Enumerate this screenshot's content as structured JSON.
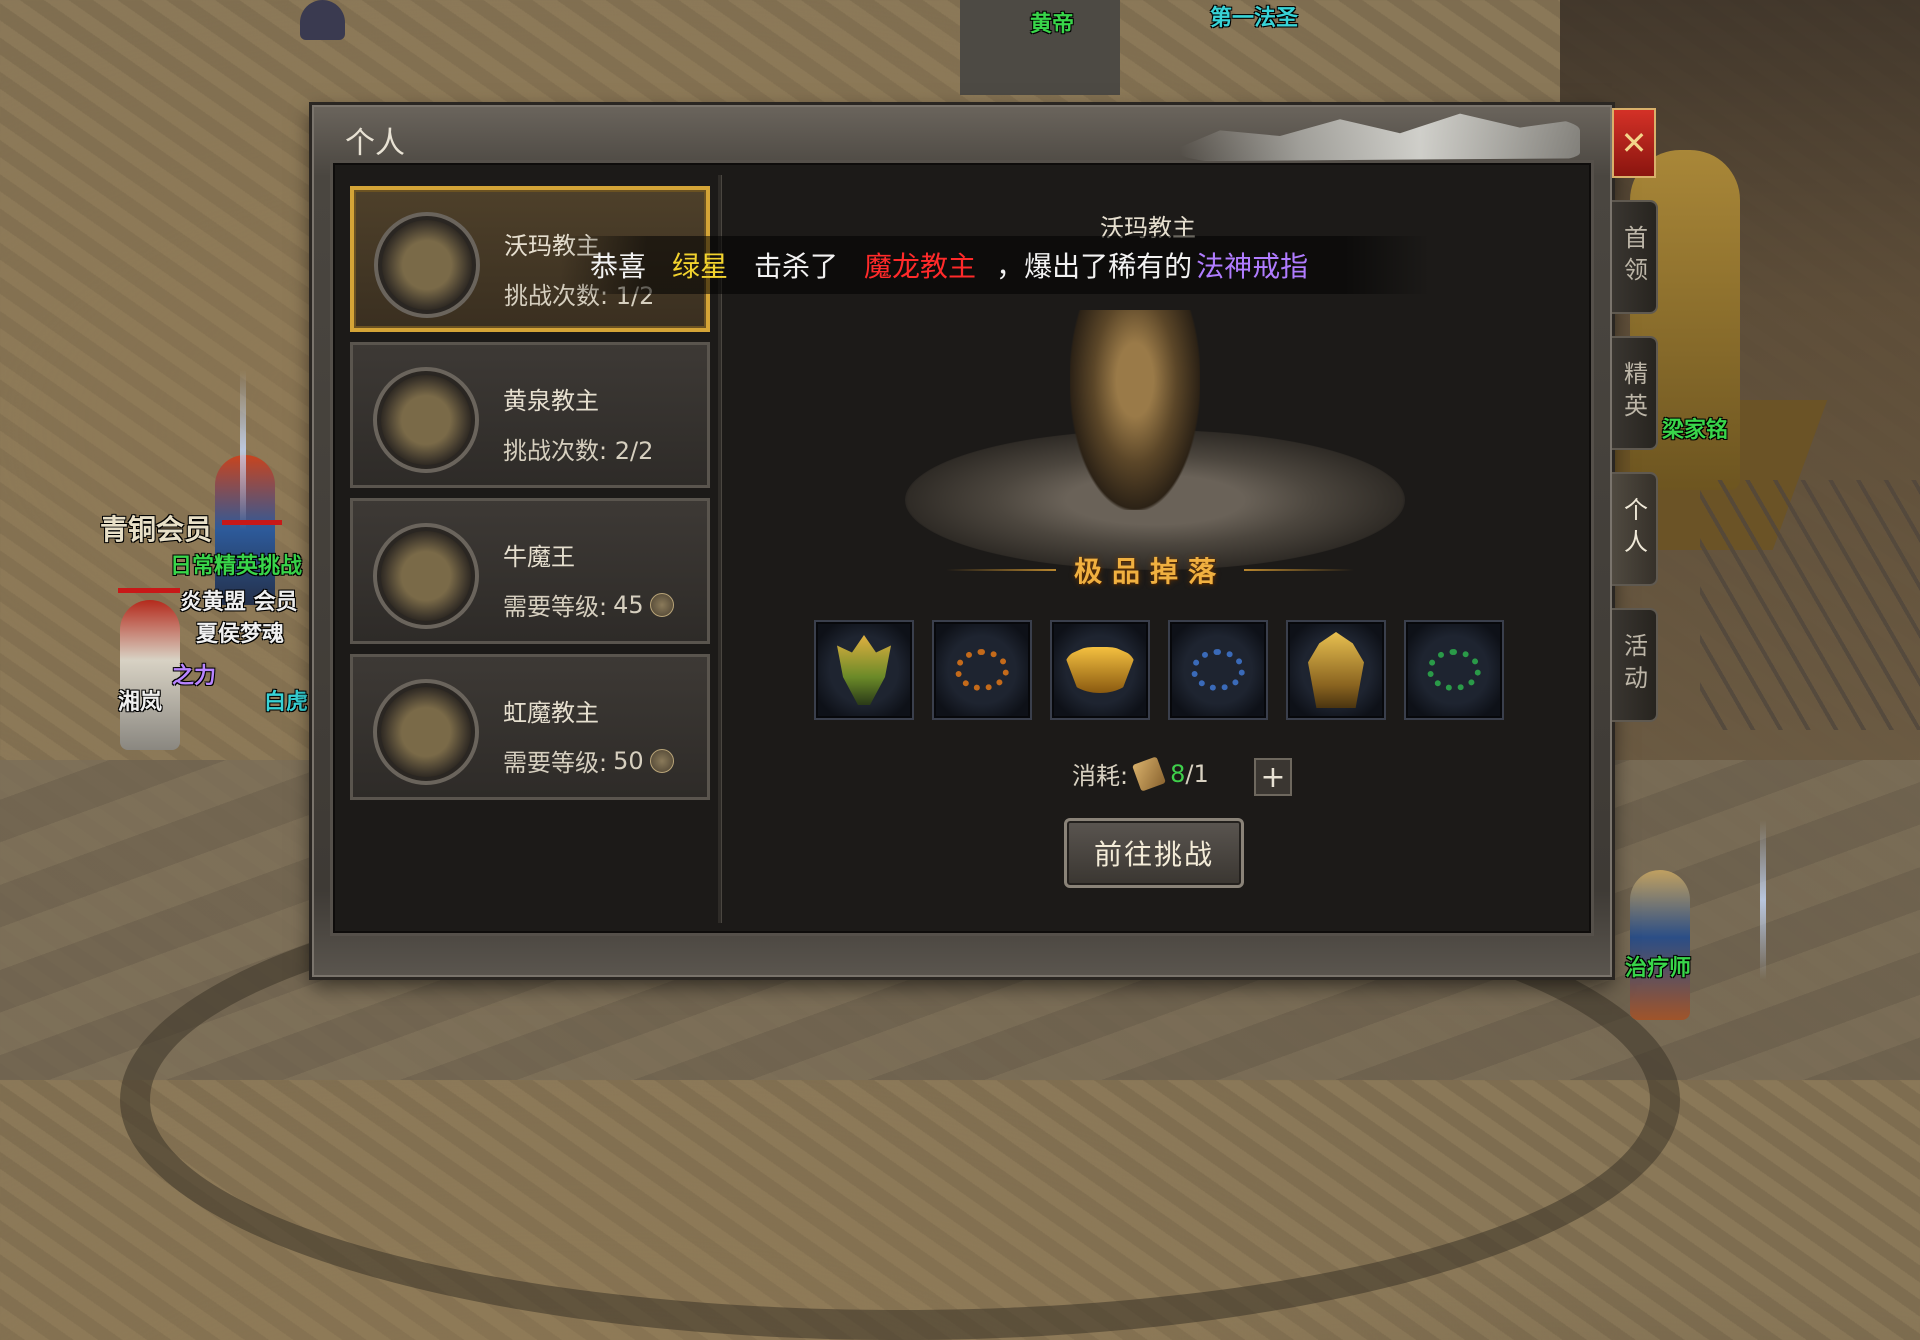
{
  "scene": {
    "player_names": {
      "top_npc_1": "黄帝",
      "top_npc_2": "第一法圣",
      "statue_name": "梁家铭",
      "healer": "治疗师",
      "member_badge": "青铜会员",
      "daily_challenge": "日常精英挑战",
      "guild": "炎黄盟 会员",
      "char_title": "夏侯梦魂",
      "power": "之力",
      "char1": "湘岚",
      "char2": "白虎"
    }
  },
  "panel": {
    "title": "个人",
    "close_label": "✕",
    "side_tabs": [
      {
        "label": "首领",
        "active": false
      },
      {
        "label": "精英",
        "active": false
      },
      {
        "label": "个人",
        "active": true
      },
      {
        "label": "活动",
        "active": false
      }
    ]
  },
  "bosses": [
    {
      "name": "沃玛教主",
      "info_label": "挑战次数:",
      "info_value": "1/2",
      "selected": true,
      "icon": "woma-portrait-icon"
    },
    {
      "name": "黄泉教主",
      "info_label": "挑战次数:",
      "info_value": "2/2",
      "selected": false,
      "icon": "huangquan-portrait-icon"
    },
    {
      "name": "牛魔王",
      "info_label": "需要等级:",
      "info_value": "45",
      "selected": false,
      "icon": "bull-demon-portrait-icon"
    },
    {
      "name": "虹魔教主",
      "info_label": "需要等级:",
      "info_value": "50",
      "selected": false,
      "icon": "hongmo-portrait-icon"
    }
  ],
  "detail": {
    "boss_name": "沃玛教主",
    "drop_title": "极品掉落",
    "drops": [
      "helmet-icon",
      "bracelet-icon",
      "ring-icon",
      "bracelet-icon",
      "armor-icon",
      "bracelet-icon"
    ],
    "cost_label": "消耗:",
    "cost_have": "8",
    "cost_need": "/1",
    "plus_label": "+",
    "challenge_button": "前往挑战"
  },
  "announcement": {
    "prefix": "恭喜",
    "player": "绿星",
    "action": "击杀了",
    "boss": "魔龙教主",
    "mid": "，爆出了稀有的",
    "item": "法神戒指",
    "colors": {
      "player": "#f2d32e",
      "boss": "#ff2a2a",
      "item": "#b07cff",
      "text": "#f2f2f2"
    }
  }
}
